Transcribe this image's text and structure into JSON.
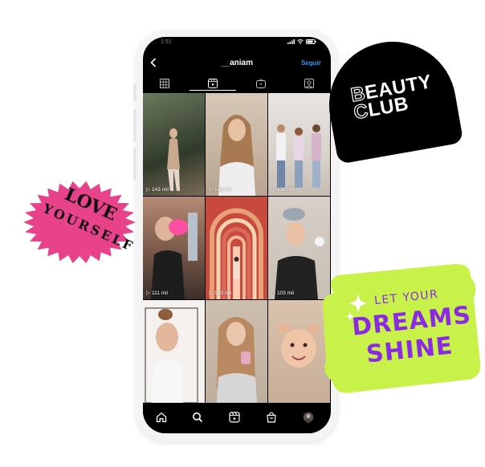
{
  "status_bar": {
    "time": "1:51"
  },
  "profile": {
    "username": "__aniam",
    "follow_label": "Seguir",
    "back_icon": "chevron-left-icon"
  },
  "tabs": [
    {
      "name": "grid",
      "icon": "grid-icon"
    },
    {
      "name": "reels",
      "icon": "reels-icon",
      "active": true
    },
    {
      "name": "igtv",
      "icon": "igtv-icon"
    },
    {
      "name": "tagged",
      "icon": "tagged-icon"
    }
  ],
  "reels": [
    {
      "views": "143 mil"
    },
    {
      "views": "143 mil"
    },
    {
      "views": "132 mil"
    },
    {
      "views": "111 mil"
    },
    {
      "views": "143 mil"
    },
    {
      "views": "103 mil"
    },
    {
      "views": ""
    },
    {
      "views": ""
    },
    {
      "views": ""
    }
  ],
  "bottom_nav": [
    "home-icon",
    "search-icon",
    "reels-icon",
    "shop-icon",
    "profile-avatar"
  ],
  "stickers": {
    "beauty_club": {
      "line1_first": "B",
      "line1_rest": "EAUTY",
      "line2_first": "C",
      "line2_rest": "LUB"
    },
    "love_yourself": {
      "line1": "LOVE",
      "line2": "YOURSELF"
    },
    "dreams": {
      "line1": "LET YOUR",
      "line2": "DREAMS",
      "line3": "SHINE"
    }
  },
  "colors": {
    "follow": "#3897f0",
    "love_sticker": "#e8428a",
    "dreams_sticker": "#c8f24a",
    "dreams_text": "#8a2be2",
    "beauty_sticker": "#000000"
  }
}
